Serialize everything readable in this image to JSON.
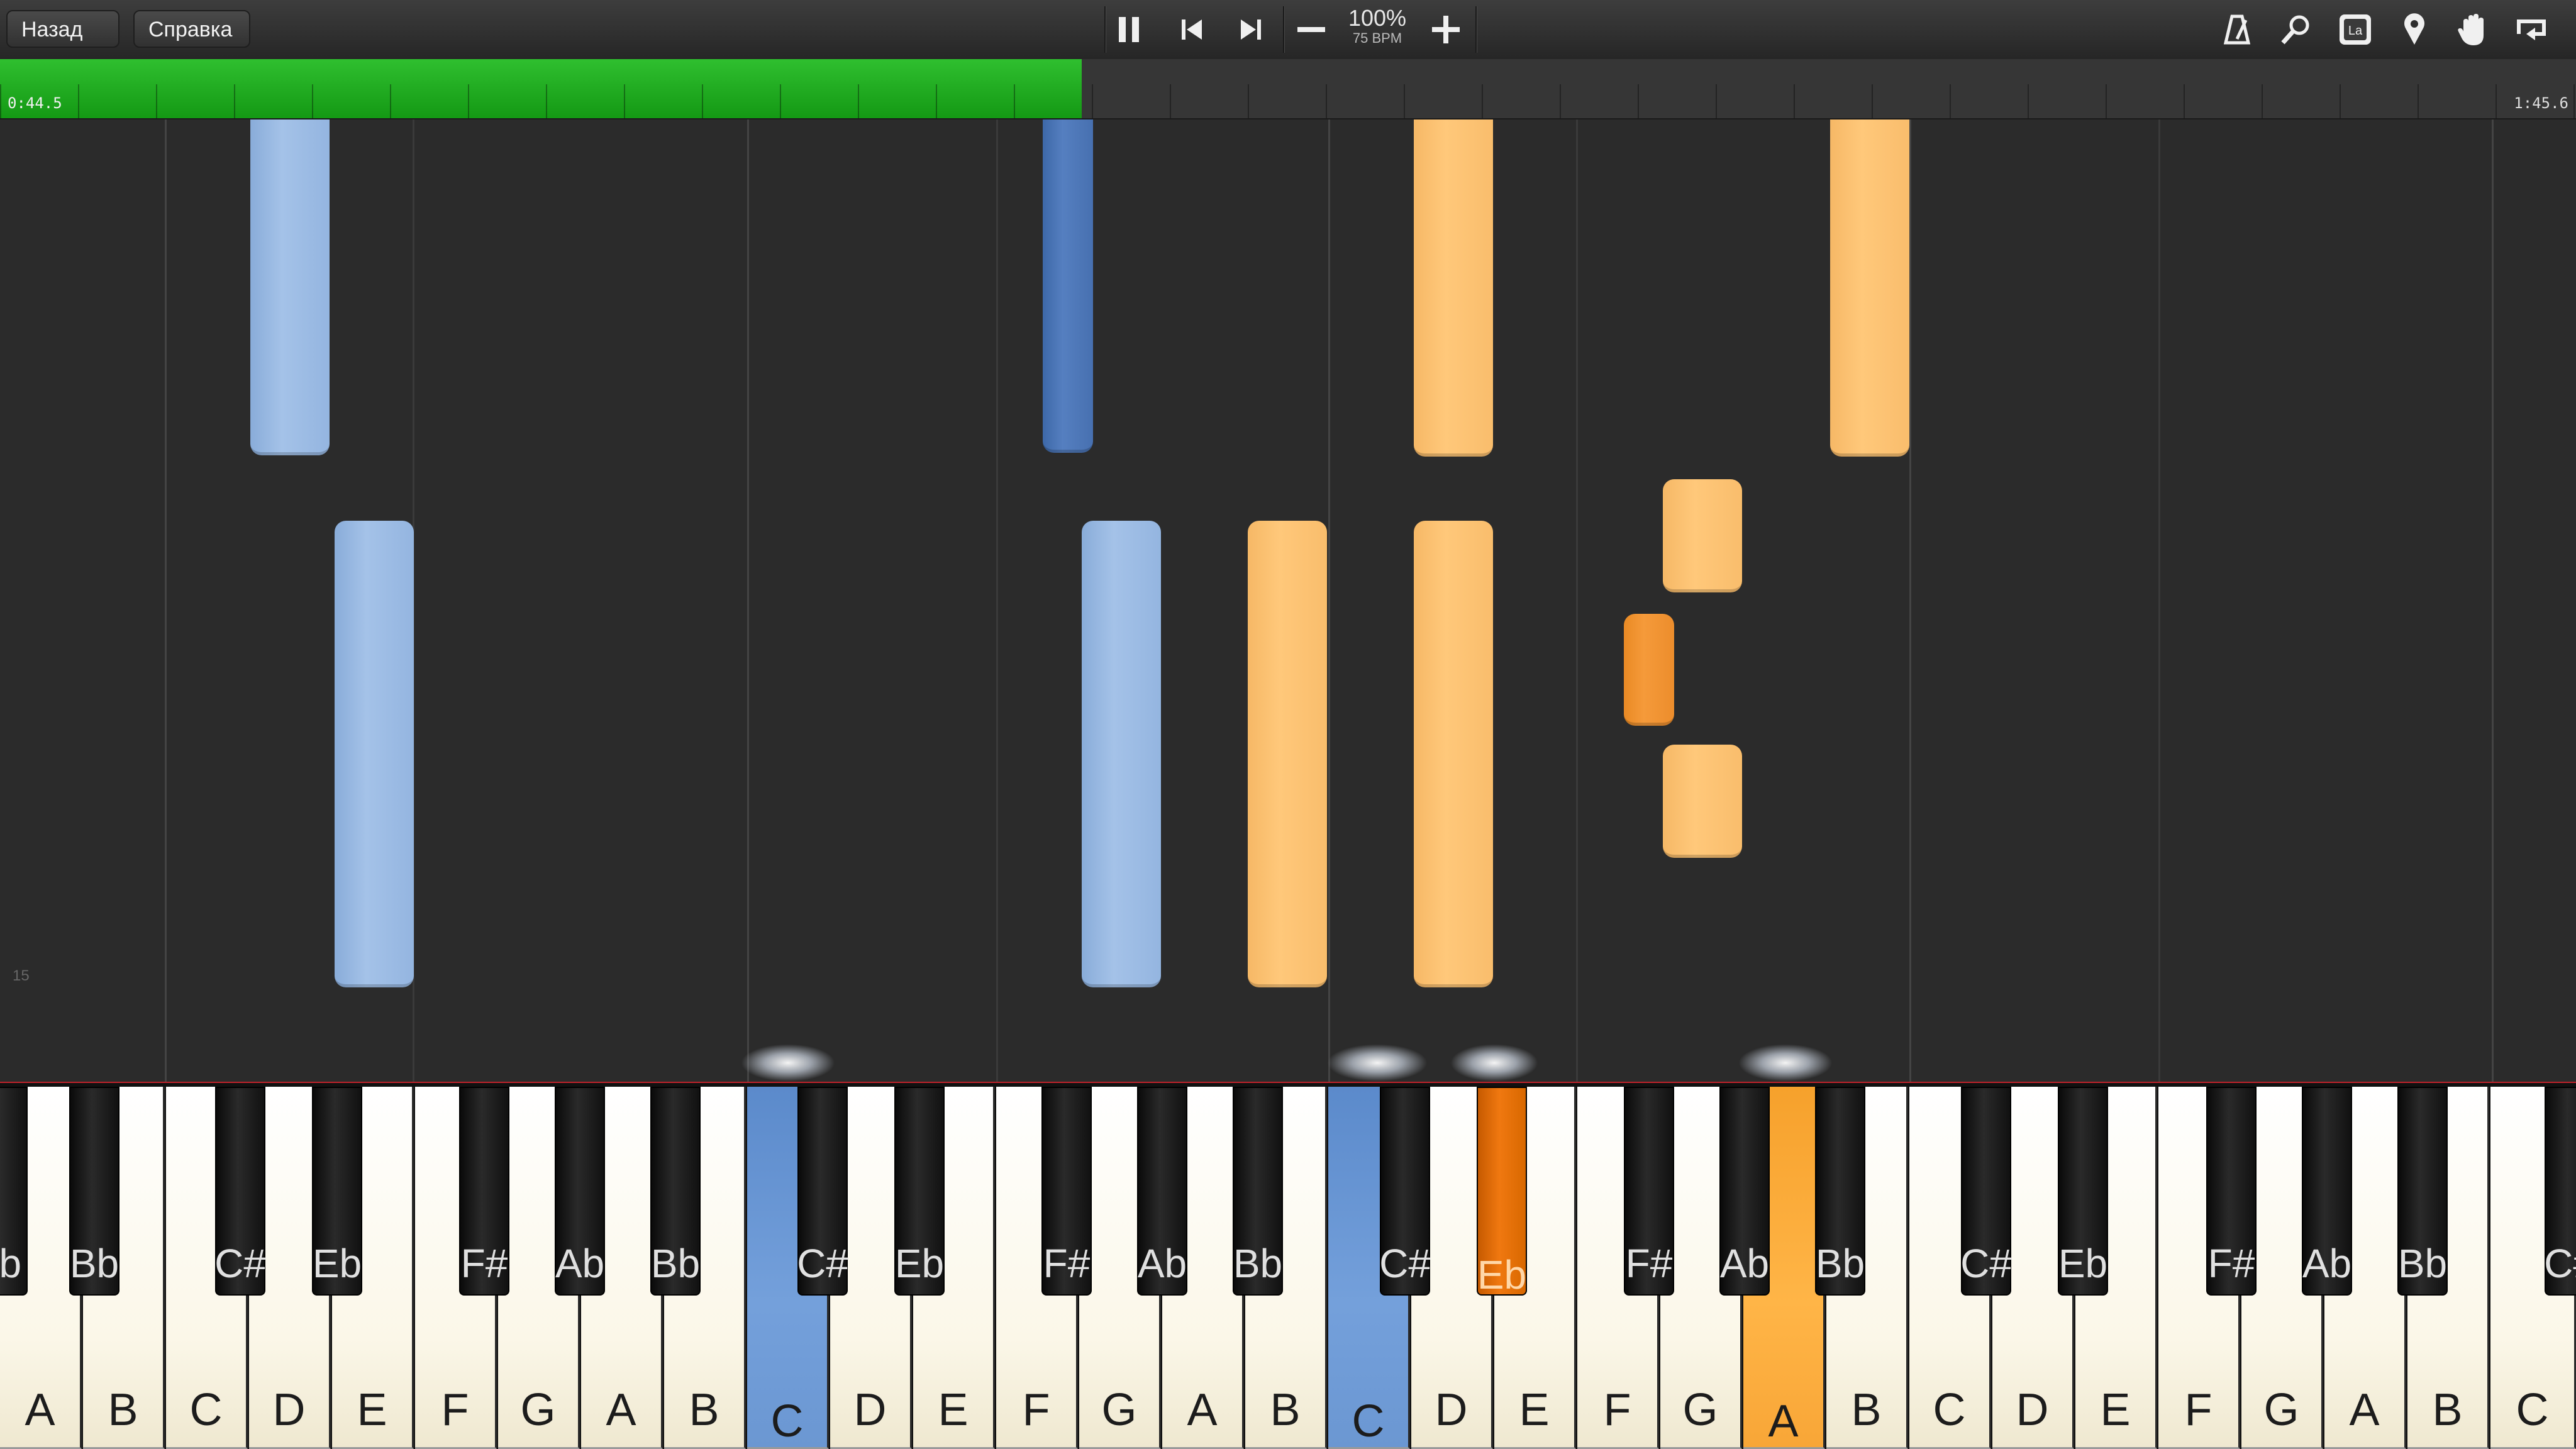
{
  "toolbar": {
    "back_label": "Назад",
    "help_label": "Справка",
    "zoom_percent": "100%",
    "tempo": "75 BPM",
    "icons": [
      "pause-icon",
      "skip-back-icon",
      "skip-forward-icon",
      "minus-icon",
      "plus-icon",
      "metronome-icon",
      "search-icon",
      "note-label-icon",
      "marker-icon",
      "hand-icon",
      "loop-icon"
    ],
    "icon_label_text": "La"
  },
  "progress": {
    "current_time": "0:44.5",
    "total_time": "1:45.6",
    "fraction": 0.42,
    "color": "#1fae1f"
  },
  "roll": {
    "measure_number": "15",
    "colors": {
      "left_hand": "#9dbce4",
      "left_hand_dark": "#4b74b5",
      "right_hand": "#ffc472",
      "right_hand_dark": "#f39332"
    }
  },
  "keyboard": {
    "white_keys": [
      "A",
      "B",
      "C",
      "D",
      "E",
      "F",
      "G",
      "A",
      "B",
      "C",
      "D",
      "E",
      "F",
      "G",
      "A",
      "B",
      "C",
      "D",
      "E",
      "F",
      "G",
      "A",
      "B",
      "C",
      "D",
      "E",
      "F",
      "G",
      "A",
      "B",
      "C"
    ],
    "black_keys": [
      "Ab",
      "Bb",
      "C#",
      "Eb",
      "F#",
      "Ab",
      "Bb",
      "C#",
      "Eb",
      "F#",
      "Ab",
      "Bb",
      "C#",
      "Eb",
      "F#",
      "Ab",
      "Bb",
      "C#",
      "Eb",
      "F#",
      "Ab",
      "Bb",
      "C#"
    ],
    "highlight_blue": "#6c98d4",
    "highlight_orange": "#f7a433"
  }
}
